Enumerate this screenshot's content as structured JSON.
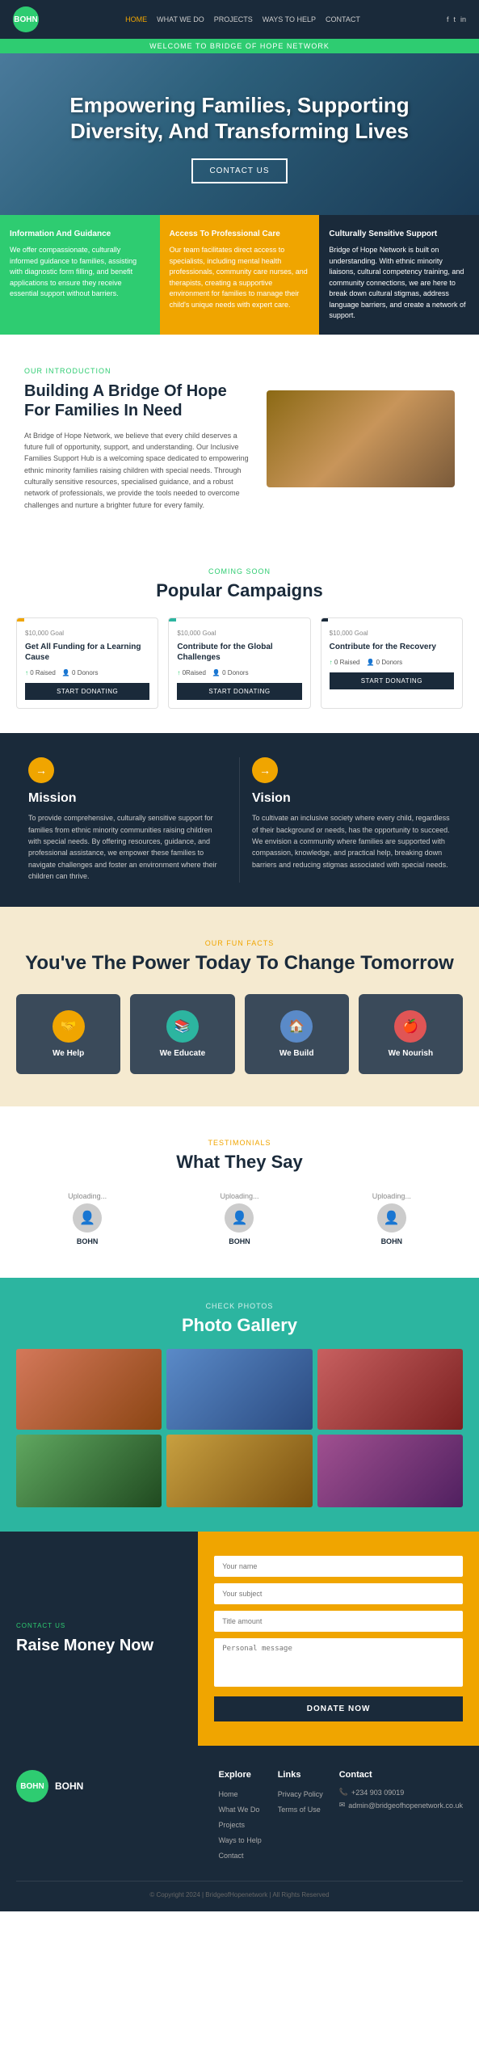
{
  "navbar": {
    "logo_text": "BOHN",
    "links": [
      "Home",
      "What We Do",
      "Projects",
      "Ways To Help",
      "Contact"
    ],
    "active_link": "Home",
    "social": [
      "f",
      "t",
      "in"
    ]
  },
  "welcome_bar": {
    "text": "WELCOME TO BRIDGE OF HOPE NETWORK"
  },
  "hero": {
    "heading": "Empowering Families, Supporting Diversity, And Transforming Lives",
    "cta_label": "CONTACT US"
  },
  "info_cards": [
    {
      "title": "Information And Guidance",
      "text": "We offer compassionate, culturally informed guidance to families, assisting with diagnostic form filling, and benefit applications to ensure they receive essential support without barriers."
    },
    {
      "title": "Access To Professional Care",
      "text": "Our team facilitates direct access to specialists, including mental health professionals, community care nurses, and therapists, creating a supportive environment for families to manage their child's unique needs with expert care."
    },
    {
      "title": "Culturally Sensitive Support",
      "text": "Bridge of Hope Network is built on understanding. With ethnic minority liaisons, cultural competency training, and community connections, we are here to break down cultural stigmas, address language barriers, and create a network of support."
    }
  ],
  "intro": {
    "label": "OUR INTRODUCTION",
    "heading": "Building A Bridge Of Hope For Families In Need",
    "text": "At Bridge of Hope Network, we believe that every child deserves a future full of opportunity, support, and understanding. Our Inclusive Families Support Hub is a welcoming space dedicated to empowering ethnic minority families raising children with special needs. Through culturally sensitive resources, specialised guidance, and a robust network of professionals, we provide the tools needed to overcome challenges and nurture a brighter future for every family."
  },
  "campaigns": {
    "label": "COMING SOON",
    "heading": "Popular Campaigns",
    "items": [
      {
        "goal": "$10,000 Goal",
        "title": "Get All Funding for a Learning Cause",
        "raised": "0 Raised",
        "donors": "0 Donors",
        "bar_color": "#f0a500",
        "btn_label": "START DONATING"
      },
      {
        "goal": "$10,000 Goal",
        "title": "Contribute for the Global Challenges",
        "raised": "0Raised",
        "donors": "0 Donors",
        "bar_color": "#2cb5a0",
        "btn_label": "START DONATING"
      },
      {
        "goal": "$10,000 Goal",
        "title": "Contribute for the Recovery",
        "raised": "0 Raised",
        "donors": "0 Donors",
        "bar_color": "#1a2a3a",
        "btn_label": "START DONATING"
      }
    ]
  },
  "mission": {
    "icon": "→",
    "title": "Mission",
    "text": "To provide comprehensive, culturally sensitive support for families from ethnic minority communities raising children with special needs. By offering resources, guidance, and professional assistance, we empower these families to navigate challenges and foster an environment where their children can thrive."
  },
  "vision": {
    "icon": "→",
    "title": "Vision",
    "text": "To cultivate an inclusive society where every child, regardless of their background or needs, has the opportunity to succeed. We envision a community where families are supported with compassion, knowledge, and practical help, breaking down barriers and reducing stigmas associated with special needs."
  },
  "fun_facts": {
    "label": "OUR FUN FACTS",
    "heading": "You've The Power Today To Change Tomorrow",
    "items": [
      {
        "icon": "🤝",
        "label": "We Help",
        "bg": "#f0a500"
      },
      {
        "icon": "📚",
        "label": "We Educate",
        "bg": "#2cb5a0"
      },
      {
        "icon": "🏠",
        "label": "We Build",
        "bg": "#5a8ac8"
      },
      {
        "icon": "🍎",
        "label": "We Nourish",
        "bg": "#e05555"
      }
    ]
  },
  "testimonials": {
    "label": "TESTIMONIALS",
    "heading": "What They Say",
    "items": [
      {
        "loading": "Uploading...",
        "name": "BOHN"
      },
      {
        "loading": "Uploading...",
        "name": "BOHN"
      },
      {
        "loading": "Uploading...",
        "name": "BOHN"
      }
    ]
  },
  "gallery": {
    "label": "CHECK PHOTOS",
    "heading": "Photo Gallery"
  },
  "donate": {
    "contact_label": "CONTACT US",
    "heading": "Raise Money Now",
    "form": {
      "your_name_placeholder": "Your name",
      "subject_placeholder": "Your subject",
      "title_placeholder": "Title amount",
      "message_placeholder": "Personal message",
      "btn_label": "DONATE NOW"
    }
  },
  "footer": {
    "logo_text": "BOHN",
    "brand_name": "BOHN",
    "explore_title": "Explore",
    "explore_links": [
      "Home",
      "What We Do",
      "Projects",
      "Ways to Help",
      "Contact"
    ],
    "links_title": "Links",
    "links_items": [
      "Privacy Policy",
      "Terms of Use"
    ],
    "contact_title": "Contact",
    "phone": "+234 903 09019",
    "email": "admin@bridgeofhopenetwork.co.uk",
    "copyright": "© Copyright 2024 | BridgeofHopenetwork | All Rights Reserved"
  }
}
